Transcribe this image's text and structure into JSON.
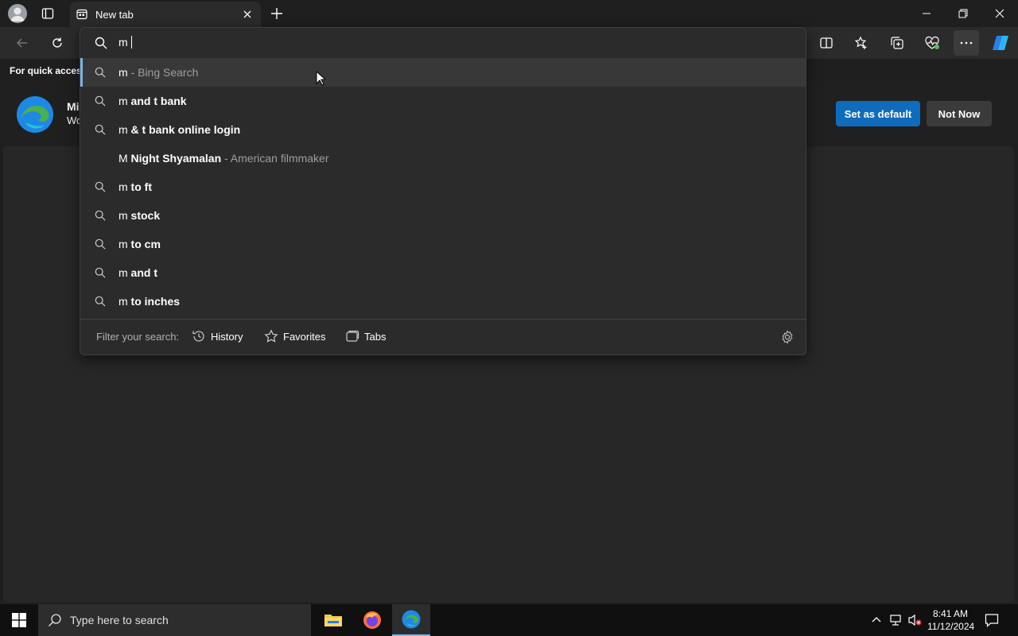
{
  "browser": {
    "tab_title": "New tab",
    "new_tab_symbol": "+",
    "icons": [
      "profile-icon",
      "tab-actions-icon",
      "tab-page-icon",
      "close-tab-icon",
      "new-tab-icon",
      "minimize-icon",
      "restore-icon",
      "close-window-icon",
      "back-icon",
      "refresh-icon",
      "split-screen-icon",
      "favorites-icon",
      "collections-icon",
      "performance-icon",
      "more-icon",
      "copilot-icon"
    ]
  },
  "page": {
    "quick_access_text": "For quick access",
    "banner_title_partial": "Mi",
    "banner_subtitle_partial": "Wo",
    "set_default_label": "Set as default",
    "not_now_label": "Not Now"
  },
  "omnibox": {
    "input_value": "m",
    "suggestions": [
      {
        "prefix": "m",
        "bold": "",
        "suffix": " - Bing Search",
        "icon": "search-icon"
      },
      {
        "prefix": "m",
        "bold": " and t bank",
        "suffix": "",
        "icon": "search-icon"
      },
      {
        "prefix": "m",
        "bold": " & t bank online login",
        "suffix": "",
        "icon": "search-icon"
      },
      {
        "prefix": "M",
        "bold": " Night Shyamalan",
        "suffix": " - American filmmaker",
        "icon": ""
      },
      {
        "prefix": "m",
        "bold": " to ft",
        "suffix": "",
        "icon": "search-icon"
      },
      {
        "prefix": "m",
        "bold": " stock",
        "suffix": "",
        "icon": "search-icon"
      },
      {
        "prefix": "m",
        "bold": " to cm",
        "suffix": "",
        "icon": "search-icon"
      },
      {
        "prefix": "m",
        "bold": " and t",
        "suffix": "",
        "icon": "search-icon"
      },
      {
        "prefix": "m",
        "bold": " to inches",
        "suffix": "",
        "icon": "search-icon"
      }
    ],
    "filter_label": "Filter your search:",
    "filters": [
      {
        "label": "History",
        "icon": "history-icon"
      },
      {
        "label": "Favorites",
        "icon": "star-icon"
      },
      {
        "label": "Tabs",
        "icon": "tabs-icon"
      }
    ]
  },
  "taskbar": {
    "search_placeholder": "Type here to search",
    "time": "8:41 AM",
    "date": "11/12/2024",
    "apps": [
      "file-explorer-icon",
      "firefox-icon",
      "edge-icon"
    ]
  },
  "colors": {
    "accent_blue": "#0f6cbd",
    "selection_bar": "#7fb2e5",
    "background": "#1f1f1f"
  }
}
